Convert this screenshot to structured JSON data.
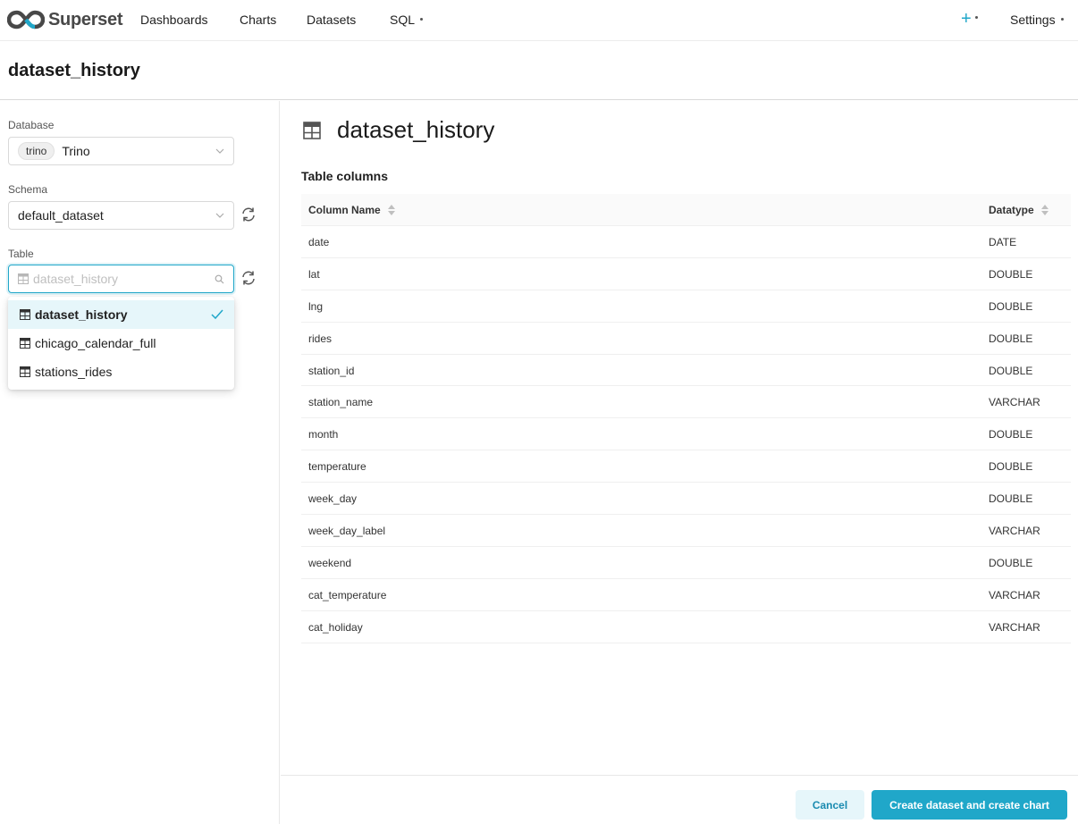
{
  "nav": {
    "brand": "Superset",
    "items": [
      "Dashboards",
      "Charts",
      "Datasets",
      "SQL"
    ],
    "settings": "Settings",
    "plus_icon": "plus-icon"
  },
  "page": {
    "title": "dataset_history"
  },
  "left": {
    "database_label": "Database",
    "database_tag": "trino",
    "database_value": "Trino",
    "schema_label": "Schema",
    "schema_value": "default_dataset",
    "table_label": "Table",
    "table_placeholder": "dataset_history",
    "dropdown": [
      "dataset_history",
      "chicago_calendar_full",
      "stations_rides"
    ],
    "selected_index": 0
  },
  "right": {
    "title": "dataset_history",
    "subtitle": "Table columns",
    "headers": {
      "name": "Column Name",
      "type": "Datatype"
    },
    "rows": [
      {
        "name": "date",
        "type": "DATE"
      },
      {
        "name": "lat",
        "type": "DOUBLE"
      },
      {
        "name": "lng",
        "type": "DOUBLE"
      },
      {
        "name": "rides",
        "type": "DOUBLE"
      },
      {
        "name": "station_id",
        "type": "DOUBLE"
      },
      {
        "name": "station_name",
        "type": "VARCHAR"
      },
      {
        "name": "month",
        "type": "DOUBLE"
      },
      {
        "name": "temperature",
        "type": "DOUBLE"
      },
      {
        "name": "week_day",
        "type": "DOUBLE"
      },
      {
        "name": "week_day_label",
        "type": "VARCHAR"
      },
      {
        "name": "weekend",
        "type": "DOUBLE"
      },
      {
        "name": "cat_temperature",
        "type": "VARCHAR"
      },
      {
        "name": "cat_holiday",
        "type": "VARCHAR"
      }
    ]
  },
  "footer": {
    "cancel": "Cancel",
    "create": "Create dataset and create chart"
  },
  "colors": {
    "accent": "#20a7c9",
    "selected_bg": "#e6f6fa"
  }
}
